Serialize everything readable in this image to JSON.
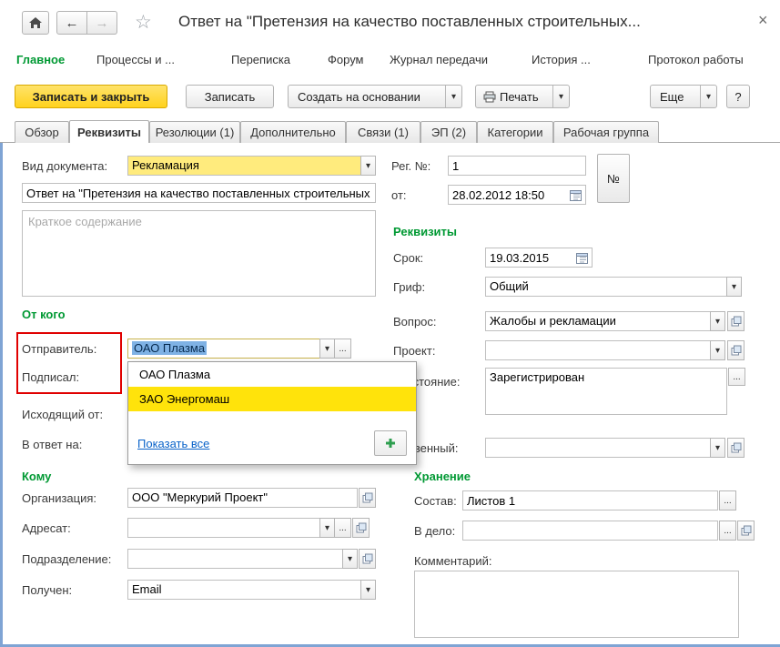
{
  "topbar": {
    "title": "Ответ на \"Претензия на качество поставленных строительных...",
    "close": "×"
  },
  "menu": {
    "items": [
      {
        "label": "Главное",
        "active": true
      },
      {
        "label": "Процессы и ..."
      },
      {
        "label": "Переписка"
      },
      {
        "label": "Форум"
      },
      {
        "label": "Журнал передачи"
      },
      {
        "label": "История ..."
      },
      {
        "label": "Протокол работы"
      }
    ]
  },
  "toolbar": {
    "save_close": "Записать и закрыть",
    "save": "Записать",
    "create_based": "Создать на основании",
    "print": "Печать",
    "more": "Еще",
    "help": "?"
  },
  "tabs": {
    "items": [
      {
        "label": "Обзор"
      },
      {
        "label": "Реквизиты",
        "active": true
      },
      {
        "label": "Резолюции (1)"
      },
      {
        "label": "Дополнительно"
      },
      {
        "label": "Связи (1)"
      },
      {
        "label": "ЭП (2)"
      },
      {
        "label": "Категории"
      },
      {
        "label": "Рабочая группа"
      }
    ]
  },
  "form": {
    "left": {
      "doc_kind_label": "Вид документа:",
      "doc_kind_value": "Рекламация",
      "name_value": "Ответ на \"Претензия на качество поставленных строительных .",
      "summary_placeholder": "Краткое содержание",
      "from_section": "От кого",
      "sender_label": "Отправитель:",
      "sender_value": "ОАО Плазма",
      "signed_label": "Подписал:",
      "outgoing_label": "Исходящий от:",
      "reply_label": "В ответ на:",
      "to_section": "Кому",
      "org_label": "Организация:",
      "org_value": "ООО \"Меркурий Проект\"",
      "addressee_label": "Адресат:",
      "department_label": "Подразделение:",
      "received_label": "Получен:",
      "received_value": "Email"
    },
    "right": {
      "regno_label": "Рег. №:",
      "regno_value": "1",
      "number_button": "№",
      "date_label": "от:",
      "date_value": "28.02.2012 18:50",
      "requisites_section": "Реквизиты",
      "due_label": "Срок:",
      "due_value": "19.03.2015",
      "grif_label": "Гриф:",
      "grif_value": "Общий",
      "question_label": "Вопрос:",
      "question_value": "Жалобы и рекламации",
      "project_label": "Проект:",
      "state_label": "Состояние:",
      "state_value": "Зарегистрирован",
      "responsible_label": "Ответственный:",
      "storage_section": "Хранение",
      "composition_label": "Состав:",
      "composition_value": "Листов 1",
      "case_label": "В дело:",
      "comment_label": "Комментарий:"
    }
  },
  "dropdown": {
    "items": [
      {
        "label": "ОАО Плазма",
        "selected": false
      },
      {
        "label": "ЗАО Энергомаш",
        "selected": true
      }
    ],
    "show_all": "Показать все",
    "add_label": "+"
  },
  "icons": {
    "back_arrow": "←",
    "forward_arrow": "→",
    "star": "☆",
    "dropdown_arrow": "▾",
    "dots": "...",
    "help": "?"
  },
  "colors": {
    "accent_green": "#009933",
    "primary_button_yellow": "#FFD21E",
    "list_highlight_yellow": "#FFE30B",
    "selection_blue": "#7FB2E5",
    "annotation_red": "#E00000",
    "link_blue": "#0A63C9"
  }
}
